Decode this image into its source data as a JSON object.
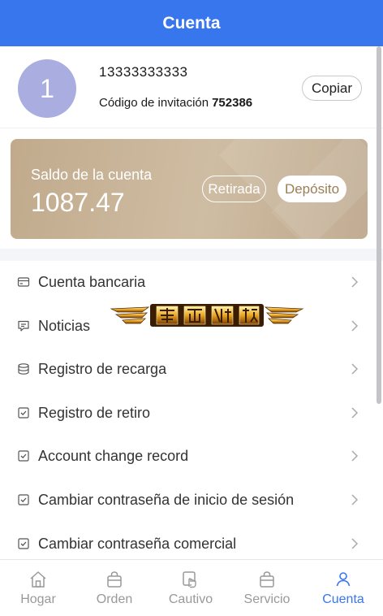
{
  "header": {
    "title": "Cuenta"
  },
  "profile": {
    "avatar_text": "1",
    "phone": "13333333333",
    "invite_label": "Código de invitación",
    "invite_code": "752386",
    "copy_label": "Copiar"
  },
  "balance": {
    "label": "Saldo de la cuenta",
    "amount": "1087.47",
    "withdraw_label": "Retirada",
    "deposit_label": "Depósito"
  },
  "menu": {
    "items": [
      {
        "label": "Cuenta bancaria",
        "icon": "card-icon"
      },
      {
        "label": "Noticias",
        "icon": "message-icon"
      },
      {
        "label": "Registro de recarga",
        "icon": "coins-icon"
      },
      {
        "label": "Registro de retiro",
        "icon": "checkbox-icon"
      },
      {
        "label": "Account change record",
        "icon": "checkbox-icon"
      },
      {
        "label": "Cambiar contraseña de inicio de sesión",
        "icon": "checkbox-icon"
      },
      {
        "label": "Cambiar contraseña comercial",
        "icon": "checkbox-icon"
      }
    ]
  },
  "tabbar": {
    "tabs": [
      {
        "label": "Hogar",
        "icon": "home-icon"
      },
      {
        "label": "Orden",
        "icon": "bag-icon"
      },
      {
        "label": "Cautivo",
        "icon": "hand-icon"
      },
      {
        "label": "Servicio",
        "icon": "bag-icon"
      },
      {
        "label": "Cuenta",
        "icon": "user-icon"
      }
    ],
    "active_tab": "Cuenta"
  },
  "colors": {
    "primary": "#3876ee",
    "balance_card": "#c7b293",
    "avatar": "#a9addf",
    "deposit_text": "#9b7e55"
  }
}
